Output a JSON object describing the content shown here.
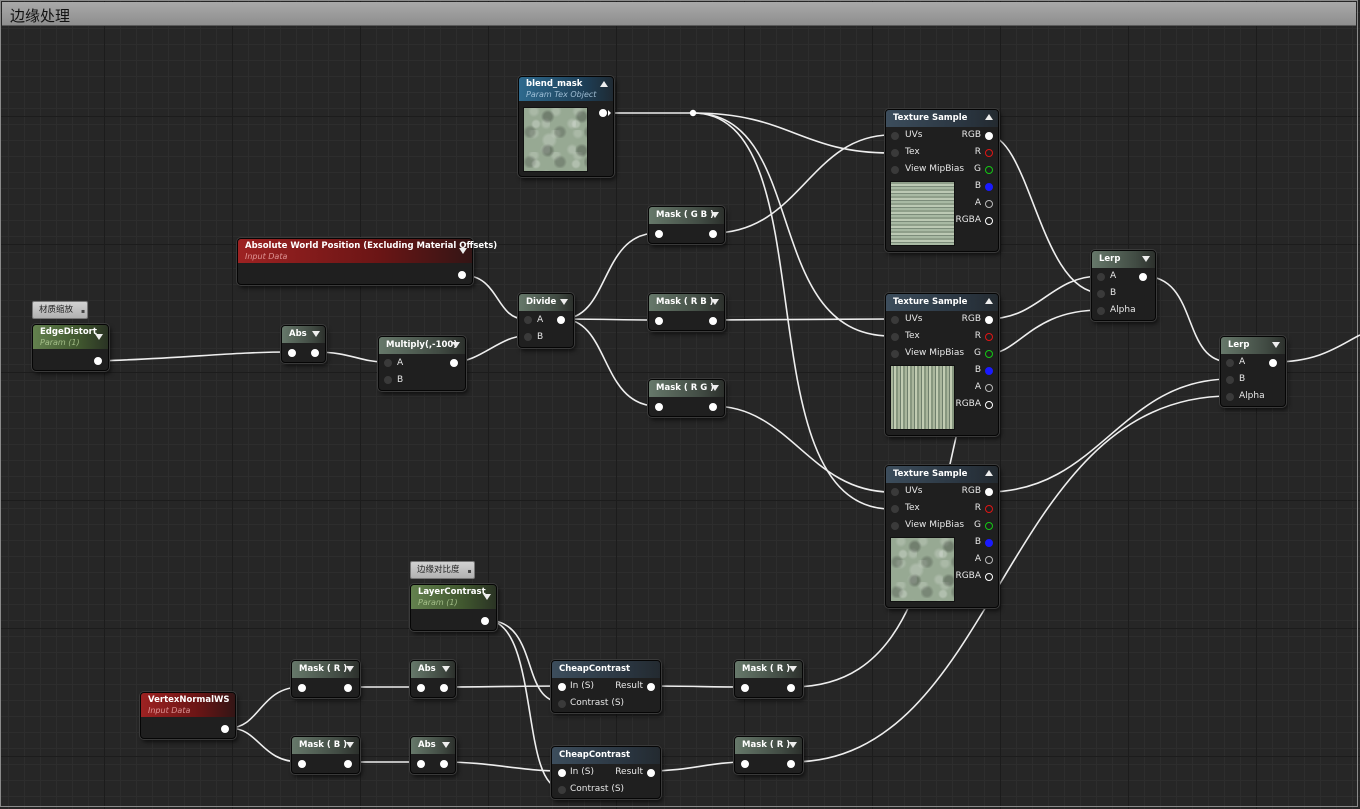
{
  "comment_box": {
    "title": "边缘处理"
  },
  "comments": {
    "edge_scale": "材质缩放",
    "edge_contrast": "边缘对比度"
  },
  "nodes": {
    "blend_mask": {
      "title": "blend_mask",
      "subtitle": "Param Tex Object"
    },
    "abs_world_pos": {
      "title": "Absolute World Position (Excluding Material Offsets)",
      "subtitle": "Input Data"
    },
    "edge_distort": {
      "title": "EdgeDistort",
      "subtitle": "Param (1)"
    },
    "abs_1": {
      "title": "Abs"
    },
    "multiply": {
      "title": "Multiply(,-100)",
      "pin_a": "A",
      "pin_b": "B"
    },
    "divide": {
      "title": "Divide",
      "pin_a": "A",
      "pin_b": "B"
    },
    "mask_gb": {
      "title": "Mask ( G B )"
    },
    "mask_rb": {
      "title": "Mask ( R B )"
    },
    "mask_rg": {
      "title": "Mask ( R G )"
    },
    "texture_sample_1": {
      "title": "Texture Sample",
      "inputs": [
        "UVs",
        "Tex",
        "View MipBias"
      ],
      "outputs": [
        "RGB",
        "R",
        "G",
        "B",
        "A",
        "RGBA"
      ]
    },
    "texture_sample_2": {
      "title": "Texture Sample",
      "inputs": [
        "UVs",
        "Tex",
        "View MipBias"
      ],
      "outputs": [
        "RGB",
        "R",
        "G",
        "B",
        "A",
        "RGBA"
      ]
    },
    "texture_sample_3": {
      "title": "Texture Sample",
      "inputs": [
        "UVs",
        "Tex",
        "View MipBias"
      ],
      "outputs": [
        "RGB",
        "R",
        "G",
        "B",
        "A",
        "RGBA"
      ]
    },
    "lerp_1": {
      "title": "Lerp",
      "inputs": [
        "A",
        "B",
        "Alpha"
      ]
    },
    "lerp_2": {
      "title": "Lerp",
      "inputs": [
        "A",
        "B",
        "Alpha"
      ]
    },
    "layer_contrast": {
      "title": "LayerContrast",
      "subtitle": "Param (1)"
    },
    "vertex_normal": {
      "title": "VertexNormalWS",
      "subtitle": "Input Data"
    },
    "mask_r_1": {
      "title": "Mask ( R )"
    },
    "mask_b": {
      "title": "Mask ( B )"
    },
    "abs_2": {
      "title": "Abs"
    },
    "abs_3": {
      "title": "Abs"
    },
    "cheap_contrast_1": {
      "title": "CheapContrast",
      "in": "In (S)",
      "contrast": "Contrast (S)",
      "out": "Result"
    },
    "cheap_contrast_2": {
      "title": "CheapContrast",
      "in": "In (S)",
      "contrast": "Contrast (S)",
      "out": "Result"
    },
    "mask_r_2": {
      "title": "Mask ( R )"
    },
    "mask_r_3": {
      "title": "Mask ( R )"
    }
  },
  "colors": {
    "pin_r": "#e01515",
    "pin_g": "#14c814",
    "pin_b": "#1a1aff",
    "wire": "#ffffff"
  }
}
